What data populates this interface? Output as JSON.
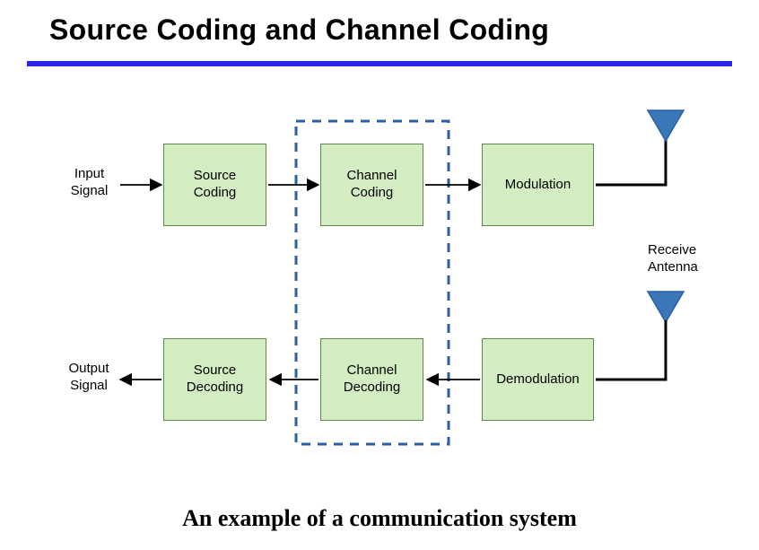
{
  "title": "Source Coding and Channel Coding",
  "caption": "An example of a communication system",
  "labels": {
    "input_signal": "Input\nSignal",
    "output_signal": "Output\nSignal",
    "receive_antenna": "Receive\nAntenna"
  },
  "boxes": {
    "source_coding": "Source\nCoding",
    "channel_coding": "Channel\nCoding",
    "modulation": "Modulation",
    "source_decoding": "Source\nDecoding",
    "channel_decoding": "Channel\nDecoding",
    "demodulation": "Demodulation"
  },
  "colors": {
    "rule": "#2a24e5",
    "box_fill": "#d4ecc2",
    "box_border": "#5b8a4a",
    "dashed": "#2b5ea5",
    "antenna_fill": "#3a77b8",
    "antenna_stroke": "#2b5ea5"
  }
}
